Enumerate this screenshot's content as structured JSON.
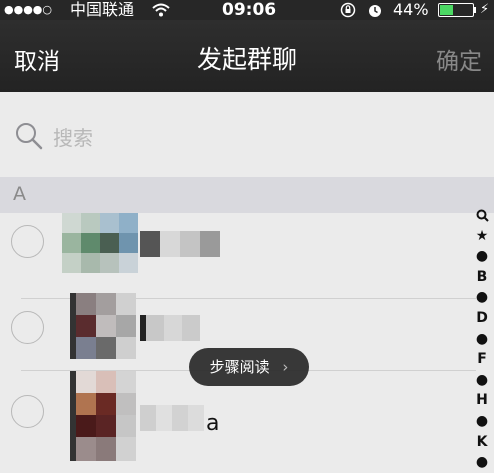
{
  "status_bar": {
    "signal": "●●●●○",
    "carrier": "中国联通",
    "wifi_icon": "wifi-icon",
    "time": "09:06",
    "orientation_lock_icon": "lock-rotation-icon",
    "alarm_icon": "alarm-icon",
    "battery_percent": "44%",
    "battery_level": 0.44,
    "charging_icon": "⚡"
  },
  "nav": {
    "cancel": "取消",
    "title": "发起群聊",
    "confirm": "确定"
  },
  "search": {
    "placeholder": "搜索"
  },
  "section": {
    "letter": "A"
  },
  "contacts": [
    {
      "visible_name_suffix": ""
    },
    {
      "visible_name_suffix": ""
    },
    {
      "visible_name_suffix": "a"
    }
  ],
  "index_bar": [
    "🔍",
    "★",
    "●",
    "B",
    "●",
    "D",
    "●",
    "F",
    "●",
    "H",
    "●",
    "K",
    "●"
  ],
  "toast": {
    "label": "步骤阅读",
    "chevron": "›"
  },
  "colors": {
    "nav_bg": "#272727",
    "list_bg": "#ebebeb",
    "section_bg": "#d9d9de",
    "battery_green": "#4cd964"
  }
}
